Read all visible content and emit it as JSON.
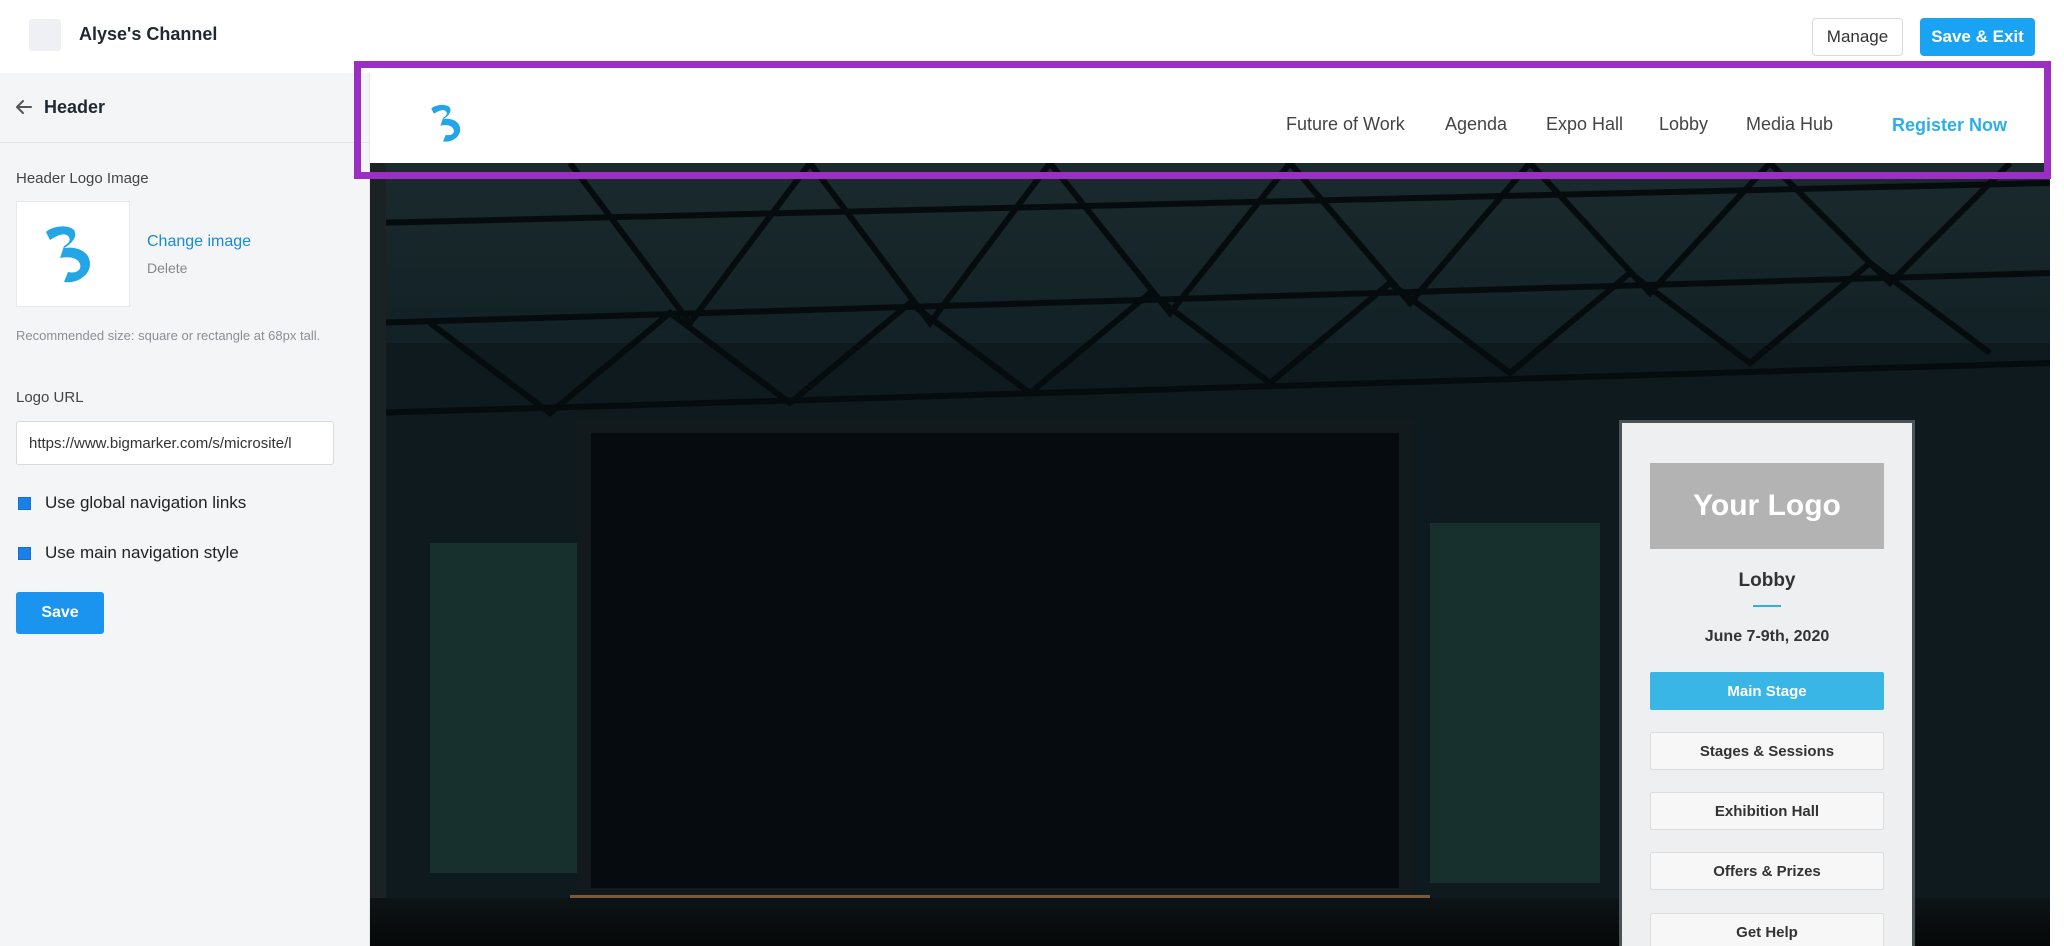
{
  "topbar": {
    "channel_name": "Alyse's Channel",
    "manage_label": "Manage",
    "save_exit_label": "Save & Exit"
  },
  "sidebar": {
    "title": "Header",
    "logo_image_label": "Header Logo Image",
    "change_image_label": "Change image",
    "delete_label": "Delete",
    "hint": "Recommended size: square or rectangle at 68px tall.",
    "logo_url_label": "Logo URL",
    "logo_url_value": "https://www.bigmarker.com/s/microsite/l",
    "checkbox_global_nav": "Use global navigation links",
    "checkbox_main_nav": "Use main navigation style",
    "global_nav_checked": true,
    "main_nav_checked": true,
    "save_label": "Save"
  },
  "preview": {
    "nav": [
      "Future of Work",
      "Agenda",
      "Expo Hall",
      "Lobby",
      "Media Hub"
    ],
    "register_label": "Register Now",
    "card": {
      "logo_text": "Your Logo",
      "title": "Lobby",
      "date": "June 7-9th, 2020",
      "buttons": [
        "Main Stage",
        "Stages & Sessions",
        "Exhibition Hall",
        "Offers & Prizes",
        "Get Help"
      ]
    }
  },
  "colors": {
    "brand_blue": "#1aa3f2",
    "accent_cyan": "#2cafe8",
    "highlight_purple": "#9b2fc4"
  }
}
